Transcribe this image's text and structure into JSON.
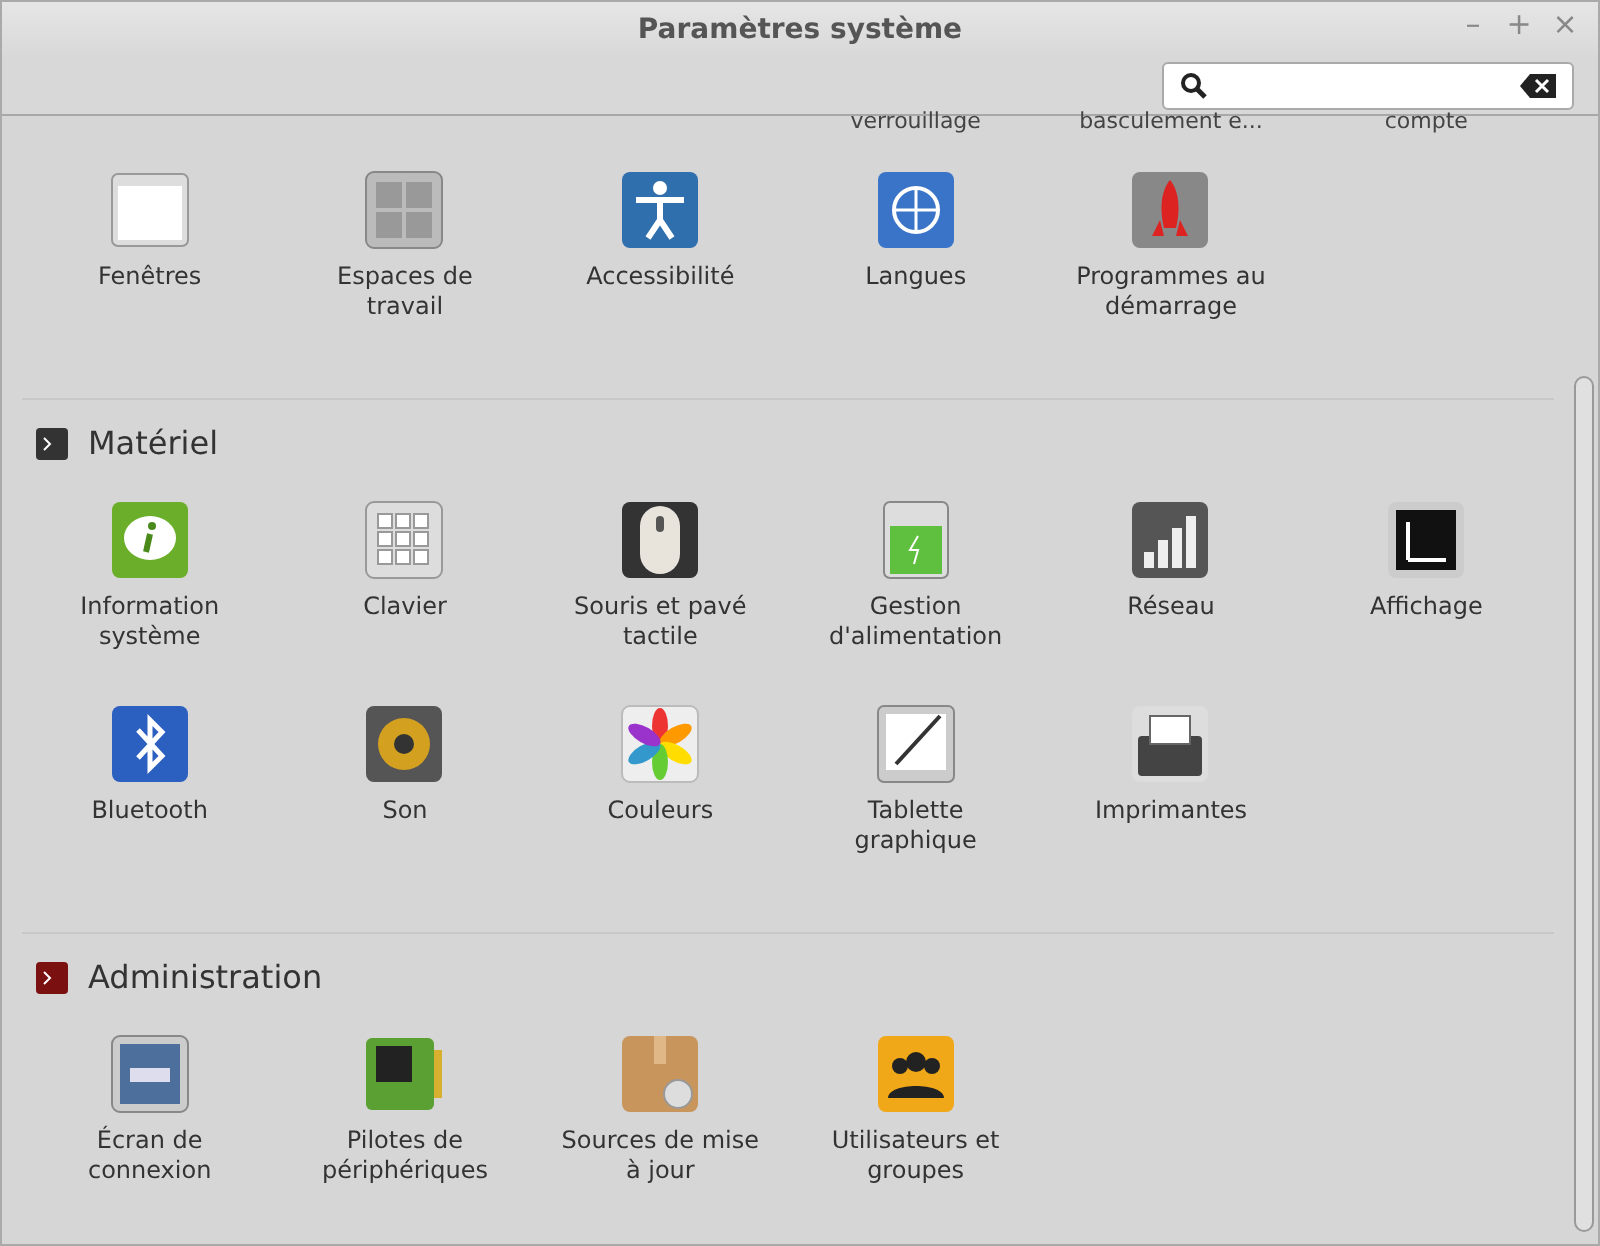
{
  "window": {
    "title": "Paramètres système",
    "controls": [
      "–",
      "+",
      "×"
    ]
  },
  "sections": [
    {
      "cut_labels": [
        "verrouillage",
        "basculement e...",
        "compte"
      ],
      "items": [
        {
          "label": "Fenêtres"
        },
        {
          "label": "Espaces de travail"
        },
        {
          "label": "Accessibilité"
        },
        {
          "label": "Langues"
        },
        {
          "label": "Programmes au démarrage"
        }
      ]
    },
    {
      "title": "Matériel",
      "items": [
        {
          "label": "Information système"
        },
        {
          "label": "Clavier"
        },
        {
          "label": "Souris et pavé tactile"
        },
        {
          "label": "Gestion d'alimentation"
        },
        {
          "label": "Réseau"
        },
        {
          "label": "Affichage"
        },
        {
          "label": "Bluetooth"
        },
        {
          "label": "Son"
        },
        {
          "label": "Couleurs"
        },
        {
          "label": "Tablette graphique"
        },
        {
          "label": "Imprimantes"
        }
      ]
    },
    {
      "title": "Administration",
      "items": [
        {
          "label": "Écran de connexion"
        },
        {
          "label": "Pilotes de périphériques"
        },
        {
          "label": "Sources de mise à jour"
        },
        {
          "label": "Utilisateurs et groupes"
        }
      ]
    }
  ]
}
